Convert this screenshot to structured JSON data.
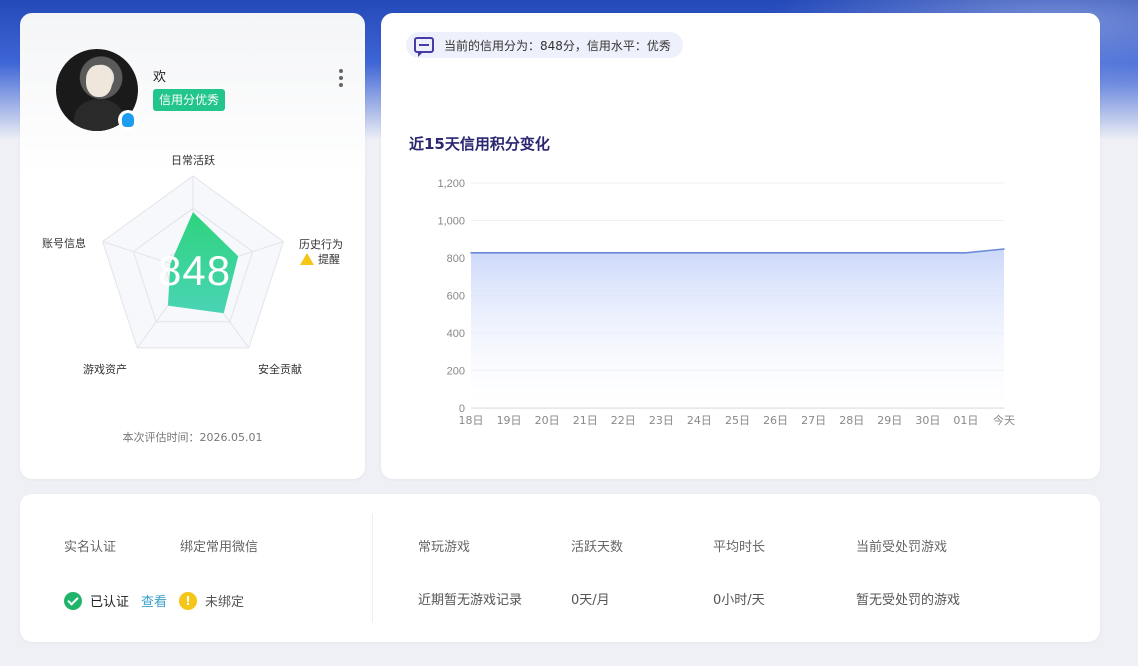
{
  "profile": {
    "username": "欢",
    "credit_tag": "信用分优秀",
    "score": "848",
    "radar_labels": {
      "top": "日常活跃",
      "right": "历史行为",
      "left": "账号信息",
      "bottom_left": "游戏资产",
      "bottom_right": "安全贡献"
    },
    "warning_text": "提醒",
    "eval_time": "本次评估时间：2026.05.01",
    "radar_values": {
      "日常活跃": 0.62,
      "历史行为": 0.5,
      "安全贡献": 0.55,
      "游戏资产": 0.45,
      "账号信息": 0.25
    }
  },
  "status": {
    "text": "当前的信用分为：848分，信用水平：优秀"
  },
  "chart_data": {
    "type": "area",
    "title": "近15天信用积分变化",
    "categories": [
      "18日",
      "19日",
      "20日",
      "21日",
      "22日",
      "23日",
      "24日",
      "25日",
      "26日",
      "27日",
      "28日",
      "29日",
      "30日",
      "01日",
      "今天"
    ],
    "values": [
      828,
      828,
      828,
      828,
      828,
      828,
      828,
      828,
      828,
      828,
      828,
      828,
      828,
      828,
      848
    ],
    "yticks": [
      "0",
      "200",
      "400",
      "600",
      "800",
      "1,000",
      "1,200"
    ],
    "ylim": [
      0,
      1200
    ],
    "grid": true,
    "line_color": "#6b8ad8",
    "fill_color": "#c9d6fa"
  },
  "info": {
    "real_name_label": "实名认证",
    "wechat_label": "绑定常用微信",
    "real_name_status": "已认证",
    "view_link": "查看",
    "wechat_status": "未绑定",
    "warn_glyph": "!",
    "frequent_game_label": "常玩游戏",
    "active_days_label": "活跃天数",
    "avg_duration_label": "平均时长",
    "punished_label": "当前受处罚游戏",
    "frequent_game_value": "近期暂无游戏记录",
    "active_days_value": "0天/月",
    "avg_duration_value": "0小时/天",
    "punished_value": "暂无受处罚的游戏"
  }
}
